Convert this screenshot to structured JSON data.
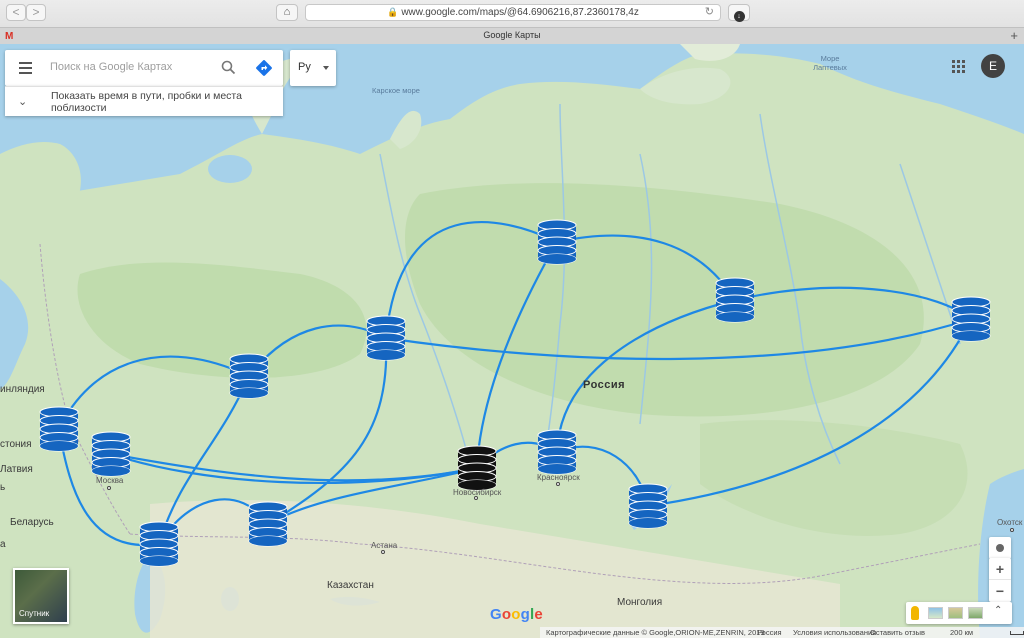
{
  "browser": {
    "url": "www.google.com/maps/@64.6906216,87.2360178,4z",
    "tab_title": "Google Карты",
    "back_label": "<",
    "forward_label": ">",
    "new_tab_label": "+",
    "gmail_label": "M"
  },
  "search": {
    "placeholder": "Поиск на Google Картах",
    "lang_label": "Ру",
    "info_text": "Показать время в пути, пробки и места поблизости"
  },
  "account": {
    "avatar_letter": "E"
  },
  "map_labels": {
    "kara_sea": "Карское море",
    "laptev_sea": "Море Лаптевых",
    "russia": "Россия",
    "finland": "инляндия",
    "estonia": "стония",
    "latvia": "Латвия",
    "belarus": "Беларусь",
    "kazakhstan": "Казахстан",
    "mongolia": "Монголия",
    "moscow": "Москва",
    "novosibirsk": "Новосибирск",
    "krasnoyarsk": "Красноярск",
    "astana": "Астана",
    "okhotsk": "Охотск",
    "letter_r": "а",
    "letter_l": "ь"
  },
  "controls": {
    "satellite_label": "Спутник",
    "zoom_in": "+",
    "zoom_out": "−"
  },
  "footer": {
    "map_data": "Картографические данные © Google,ORION-ME,ZENRIN, 2019",
    "region": "Россия",
    "terms": "Условия использования",
    "feedback": "Оставить отзыв",
    "scale": "200 км"
  },
  "logo": {
    "g1": "G",
    "o1": "o",
    "o2": "o",
    "g2": "g",
    "l": "l",
    "e": "e"
  },
  "colors": {
    "route": "#1e88e5",
    "node": "#1565c0",
    "node_highlight": "#111111"
  }
}
